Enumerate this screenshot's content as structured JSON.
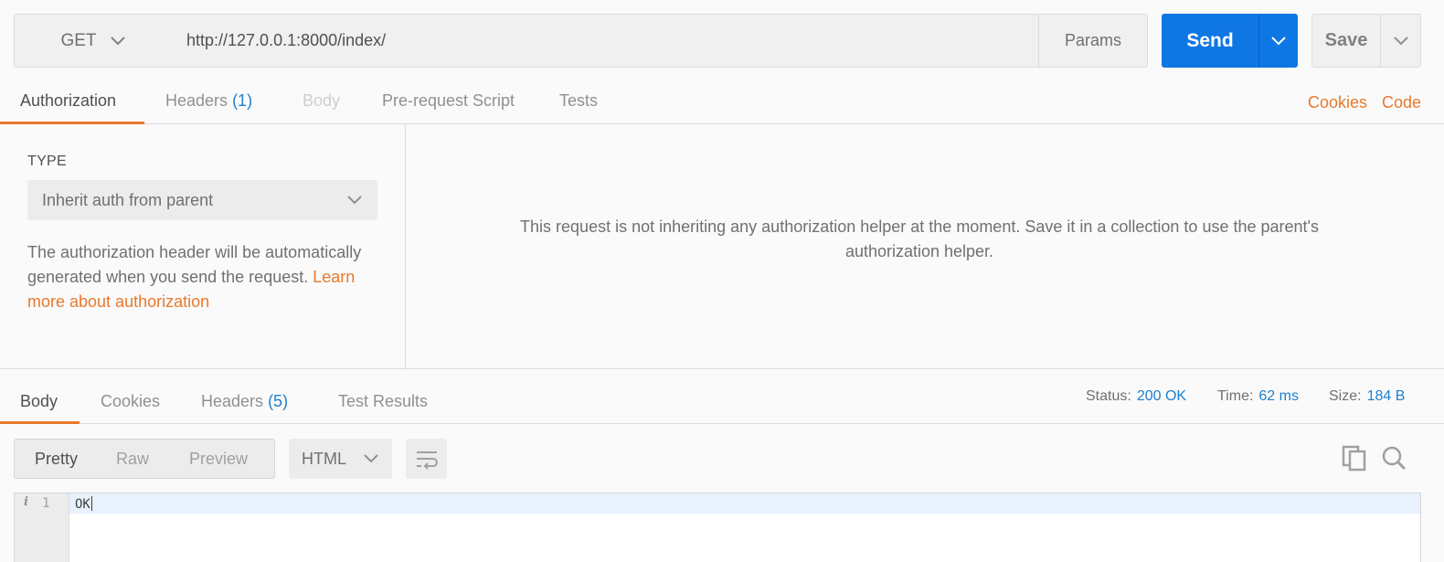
{
  "request": {
    "method": "GET",
    "url": "http://127.0.0.1:8000/index/",
    "params_label": "Params",
    "send_label": "Send",
    "save_label": "Save"
  },
  "request_tabs": {
    "authorization": "Authorization",
    "headers": "Headers",
    "headers_count": "(1)",
    "body": "Body",
    "prerequest": "Pre-request Script",
    "tests": "Tests",
    "cookies_link": "Cookies",
    "code_link": "Code"
  },
  "auth": {
    "type_label": "TYPE",
    "type_value": "Inherit auth from parent",
    "description": "The authorization header will be automatically generated when you send the request.",
    "learn_more": "Learn more about authorization",
    "message": "This request is not inheriting any authorization helper at the moment. Save it in a collection to use the parent's authorization helper."
  },
  "response": {
    "tabs": {
      "body": "Body",
      "cookies": "Cookies",
      "headers": "Headers",
      "headers_count": "(5)",
      "test_results": "Test Results"
    },
    "status_label": "Status:",
    "status_value": "200 OK",
    "time_label": "Time:",
    "time_value": "62 ms",
    "size_label": "Size:",
    "size_value": "184 B",
    "formats": {
      "pretty": "Pretty",
      "raw": "Raw",
      "preview": "Preview"
    },
    "language": "HTML",
    "line_number": "1",
    "content": "OK"
  },
  "colors": {
    "accent_orange": "#e8792c",
    "send_blue": "#0f77e3",
    "value_blue": "#1f7fcf"
  }
}
